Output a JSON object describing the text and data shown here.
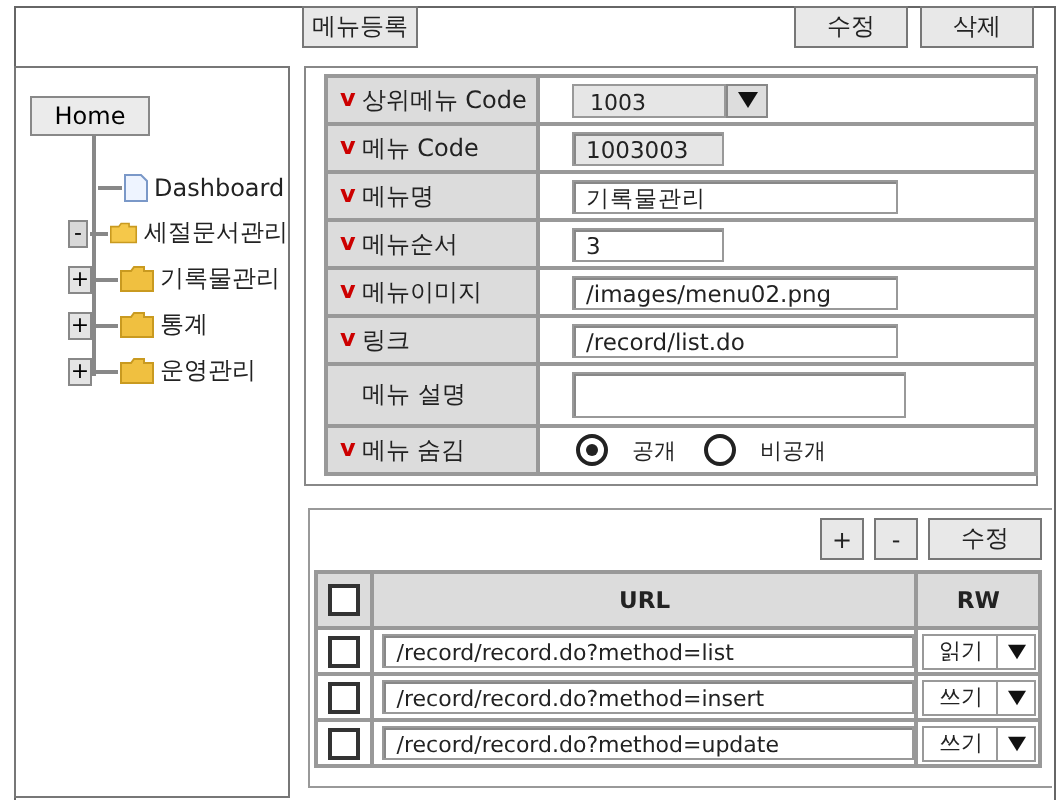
{
  "toolbar": {
    "title_button": "메뉴등록",
    "buttons": [
      "수정",
      "삭제"
    ]
  },
  "tree": {
    "root": "Home",
    "children": [
      {
        "label": "Dashboard",
        "kind": "page"
      },
      {
        "label": "세절문서관리",
        "kind": "folder",
        "toggle": "-",
        "expanded": true
      },
      {
        "label": "기록물관리",
        "kind": "folder",
        "toggle": "+",
        "expanded": false
      },
      {
        "label": "통계",
        "kind": "folder",
        "toggle": "+",
        "expanded": false
      },
      {
        "label": "운영관리",
        "kind": "folder",
        "toggle": "+",
        "expanded": false
      }
    ]
  },
  "form": {
    "rows": [
      {
        "mark": "v",
        "label": "상위메뉴 Code",
        "kind": "select",
        "value": "1003"
      },
      {
        "mark": "v",
        "label": "메뉴 Code",
        "kind": "readonly",
        "value": "1003003"
      },
      {
        "mark": "v",
        "label": "메뉴명",
        "kind": "text",
        "value": "기록물관리"
      },
      {
        "mark": "v",
        "label": "메뉴순서",
        "kind": "short",
        "value": "3"
      },
      {
        "mark": "v",
        "label": "메뉴이미지",
        "kind": "text",
        "value": "/images/menu02.png"
      },
      {
        "mark": "v",
        "label": "링크",
        "kind": "text",
        "value": "/record/list.do"
      },
      {
        "label": "메뉴 설명",
        "kind": "textarea"
      },
      {
        "mark": "v",
        "label": "메뉴 숨김",
        "kind": "radio",
        "options": [
          {
            "label": "공개",
            "selected": true
          },
          {
            "label": "비공개",
            "selected": false
          }
        ]
      }
    ]
  },
  "url_panel": {
    "buttons": [
      "+",
      "-",
      "수정"
    ],
    "columns": [
      "URL",
      "RW"
    ],
    "header_checked": false,
    "rows": [
      {
        "checked": false,
        "url": "/record/record.do?method=list",
        "rw": "읽기"
      },
      {
        "checked": false,
        "url": "/record/record.do?method=insert",
        "rw": "쓰기"
      },
      {
        "checked": false,
        "url": "/record/record.do?method=update",
        "rw": "쓰기"
      }
    ]
  }
}
